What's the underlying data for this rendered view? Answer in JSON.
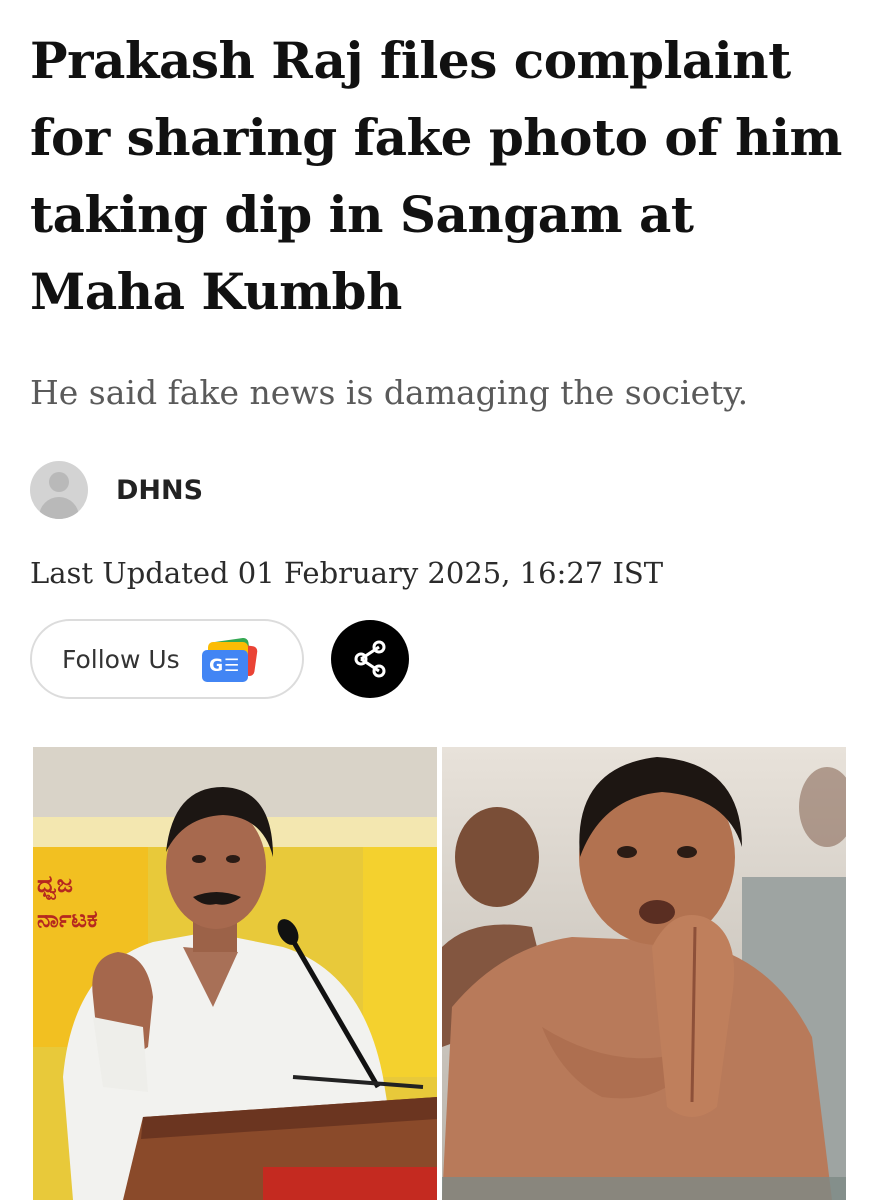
{
  "article": {
    "headline": "Prakash Raj files complaint for sharing fake photo of him taking dip in Sangam at Maha Kumbh",
    "subheadline": "He said fake news is damaging the society.",
    "author": "DHNS",
    "last_updated": "Last Updated 01 February 2025, 16:27 IST"
  },
  "actions": {
    "follow_label": "Follow Us",
    "google_news_icon_text": "G☰",
    "share_icon": "share-icon"
  },
  "photos": {
    "left_sign_text_1": "ಧ್ವಜ",
    "left_sign_text_2": "ರ್ನಾಟಕ"
  }
}
